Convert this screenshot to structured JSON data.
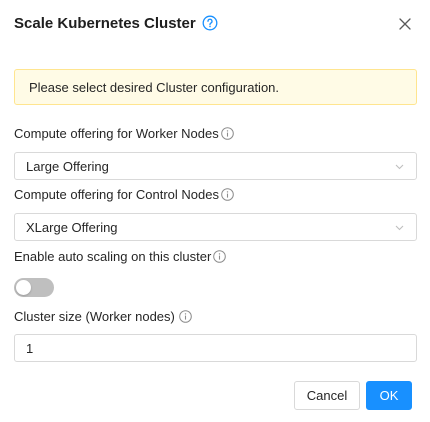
{
  "modal": {
    "title": "Scale Kubernetes Cluster",
    "alert": "Please select desired Cluster configuration.",
    "fields": {
      "worker_offering": {
        "label": "Compute offering for Worker Nodes",
        "value": "Large Offering"
      },
      "control_offering": {
        "label": "Compute offering for Control Nodes",
        "value": "XLarge Offering"
      },
      "auto_scaling": {
        "label": "Enable auto scaling on this cluster",
        "enabled": false
      },
      "cluster_size": {
        "label": "Cluster size (Worker nodes)",
        "value": "1"
      }
    },
    "buttons": {
      "cancel": "Cancel",
      "ok": "OK"
    }
  },
  "colors": {
    "primary": "#1890ff",
    "alert_bg": "#fffbe6",
    "alert_border": "#ffe58f",
    "toggle_off": "#bfbfbf"
  },
  "icons": {
    "title_help": "question-circle-icon",
    "close": "close-icon",
    "field_info": "info-circle-icon",
    "select_arrow": "chevron-down-icon"
  }
}
